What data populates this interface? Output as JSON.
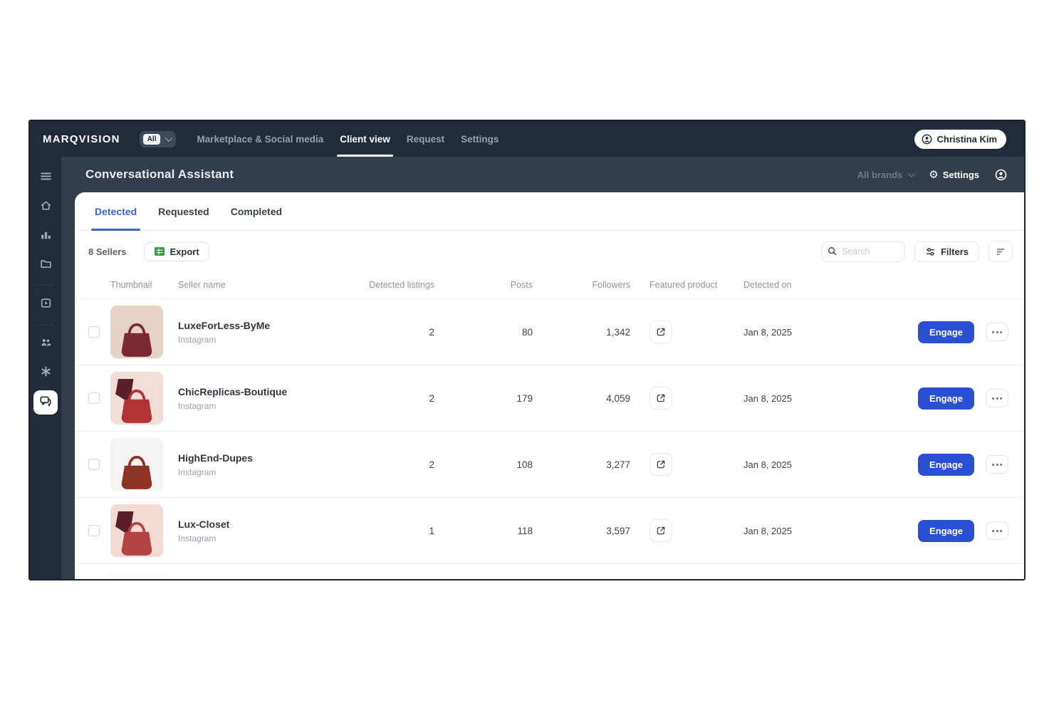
{
  "topbar": {
    "brand": "MARQVISION",
    "org_badge": "All",
    "nav_items": [
      {
        "label": "Marketplace & Social media",
        "active": false
      },
      {
        "label": "Client view",
        "active": true
      },
      {
        "label": "Request",
        "active": false
      },
      {
        "label": "Settings",
        "active": false
      }
    ],
    "user_button": "Christina Kim"
  },
  "subheader": {
    "title": "Conversational Assistant",
    "brand_selector": "All brands",
    "settings_label": "Settings"
  },
  "sidebar": {
    "items": [
      "menu",
      "home",
      "analytics",
      "projects",
      "media",
      "team",
      "automation",
      "conversations"
    ],
    "active_item": "conversations"
  },
  "tabs": [
    {
      "label": "Detected",
      "active": true
    },
    {
      "label": "Requested",
      "active": false
    },
    {
      "label": "Completed",
      "active": false
    }
  ],
  "toolbar": {
    "sellers_count": "8 Sellers",
    "export_label": "Export",
    "search_placeholder": "Search",
    "filters_label": "Filters"
  },
  "table": {
    "headers": [
      "Thumbnail",
      "Seller name",
      "Detected listings",
      "Posts",
      "Followers",
      "Featured product",
      "Detected on"
    ],
    "engage_label": "Engage",
    "rows": [
      {
        "seller_name": "LuxeForLess-ByMe",
        "platform": "Instagram",
        "detected_listings": "2",
        "posts": "80",
        "followers": "1,342",
        "detected_on": "Jan 8, 2025",
        "thumb_bg": "#e7d3c6",
        "bag_color": "#7b2a33",
        "arm": false
      },
      {
        "seller_name": "ChicReplicas-Boutique",
        "platform": "Instagram",
        "detected_listings": "2",
        "posts": "179",
        "followers": "4,059",
        "detected_on": "Jan 8, 2025",
        "thumb_bg": "#f2ded7",
        "bag_color": "#b23434",
        "arm": true
      },
      {
        "seller_name": "HighEnd-Dupes",
        "platform": "Instagram",
        "detected_listings": "2",
        "posts": "108",
        "followers": "3,277",
        "detected_on": "Jan 8, 2025",
        "thumb_bg": "#f6f4f2",
        "bag_color": "#8c3326",
        "arm": false
      },
      {
        "seller_name": "Lux-Closet",
        "platform": "Instagram",
        "detected_listings": "1",
        "posts": "118",
        "followers": "3,597",
        "detected_on": "Jan 8, 2025",
        "thumb_bg": "#f3dad3",
        "bag_color": "#b54343",
        "arm": true
      }
    ]
  },
  "colors": {
    "accent_blue": "#2b4fd3",
    "topbar_bg": "#212c38",
    "subheader_bg": "#333e4a",
    "export_green": "#2f9e49"
  }
}
